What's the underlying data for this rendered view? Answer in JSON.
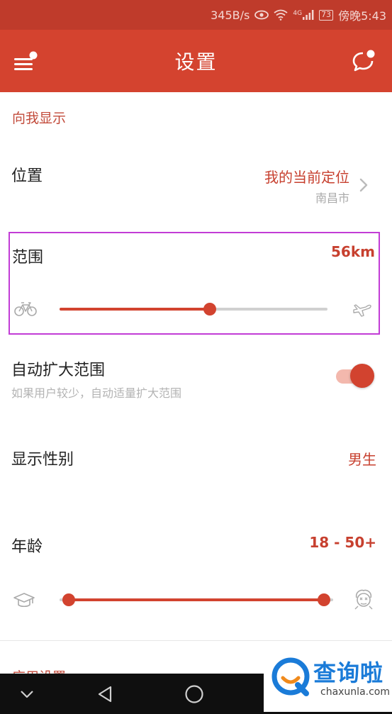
{
  "status_bar": {
    "speed": "345B/s",
    "network": "4G",
    "battery": "73",
    "time": "傍晚5:43"
  },
  "app_bar": {
    "title": "设置"
  },
  "section": {
    "header": "向我显示"
  },
  "location": {
    "label": "位置",
    "value": "我的当前定位",
    "sub": "南昌市"
  },
  "range": {
    "label": "范围",
    "value": "56km",
    "slider_fraction": 0.56,
    "min_icon": "bicycle-icon",
    "max_icon": "airplane-icon"
  },
  "auto_expand": {
    "label": "自动扩大范围",
    "description": "如果用户较少，自动适量扩大范围",
    "enabled": true
  },
  "gender": {
    "label": "显示性别",
    "value": "男生"
  },
  "age": {
    "label": "年龄",
    "value": "18 - 50+",
    "min_fraction": 0.0,
    "max_fraction": 1.0,
    "min_icon": "graduation-cap-icon",
    "max_icon": "elder-face-icon"
  },
  "next_section": {
    "header": "应用设置"
  },
  "nav_bar": {
    "items": [
      "collapse-icon",
      "back-icon",
      "home-icon",
      "recents-icon"
    ]
  },
  "watermark": {
    "text_cn": "查询啦",
    "text_en": "chaxunla.com"
  },
  "colors": {
    "accent": "#d2432f",
    "status_bar": "#bf3b2b",
    "highlight_box": "#c23cd6"
  }
}
